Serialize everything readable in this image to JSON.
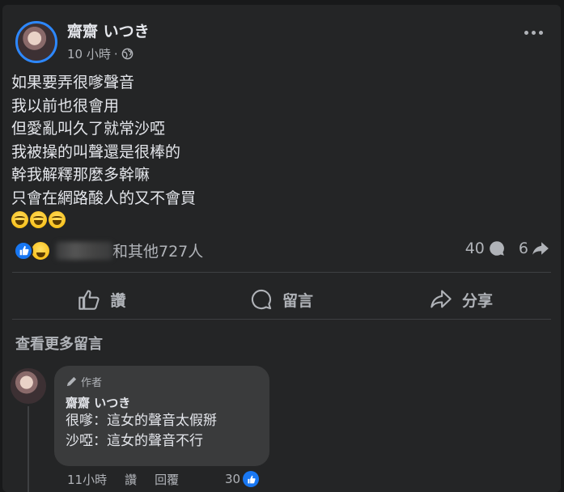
{
  "post": {
    "author_name": "齋齋 いつき",
    "timestamp": "10 小時",
    "separator": "·",
    "lines": [
      "如果要弄很嗲聲音",
      "我以前也很會用",
      "但愛亂叫久了就常沙啞",
      "我被操的叫聲還是很棒的",
      "幹我解釋那麼多幹嘛",
      "只會在網路酸人的又不會買"
    ],
    "emoji_count": 3
  },
  "reactions": {
    "summary_text": "和其他727人",
    "comment_count": "40",
    "share_count": "6"
  },
  "actions": {
    "like_label": "讚",
    "comment_label": "留言",
    "share_label": "分享"
  },
  "comments_section": {
    "view_more_label": "查看更多留言"
  },
  "comment": {
    "badge_label": "作者",
    "author_name": "齋齋 いつき",
    "lines": [
      "很嗲：這女的聲音太假掰",
      "沙啞：這女的聲音不行"
    ],
    "time": "11小時",
    "like_label": "讚",
    "reply_label": "回覆",
    "like_count": "30"
  },
  "colors": {
    "background": "#18191a",
    "card": "#242526",
    "bubble": "#3a3b3c",
    "accent": "#1877f2",
    "text_primary": "#e4e6eb",
    "text_secondary": "#b0b3b8"
  }
}
